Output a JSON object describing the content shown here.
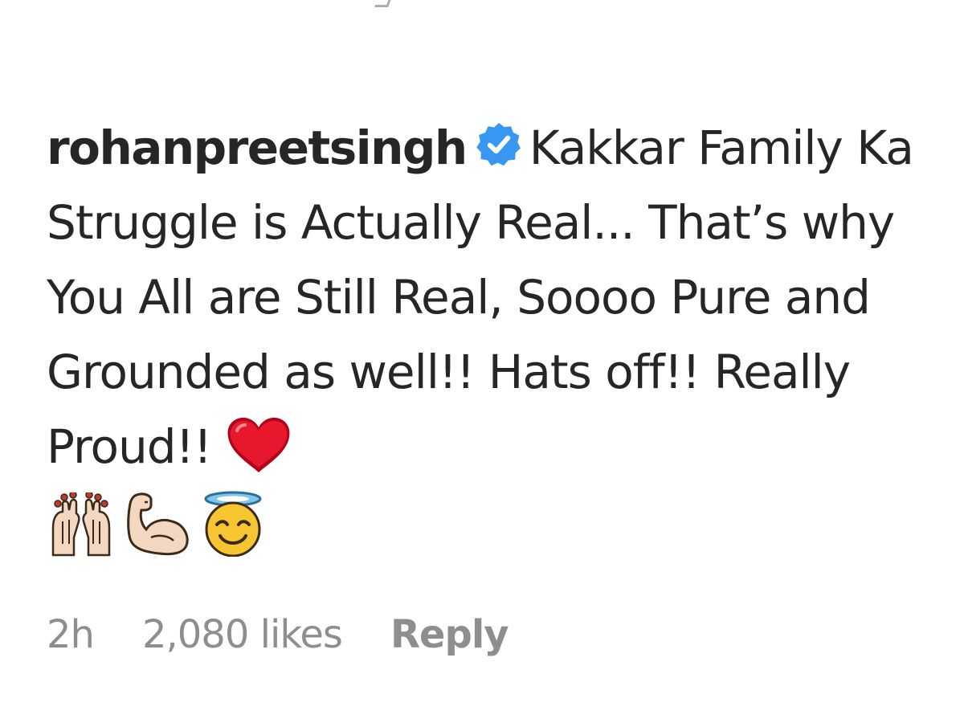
{
  "comment": {
    "username": "rohanpreetsingh",
    "verified": true,
    "text": "Kakkar Family Ka Struggle is Actually Real... That’s why You All are Still Real, Soooo Pure and Grounded as well!! Hats off!! Really Proud!!",
    "inline_emoji": "red-heart",
    "trailing_emojis": [
      "raising-hands",
      "flexed-biceps",
      "smiling-face-with-halo"
    ]
  },
  "meta": {
    "time": "2h",
    "likes": "2,080 likes",
    "reply_label": "Reply"
  },
  "colors": {
    "text": "#262626",
    "muted": "#8e8e8e",
    "verified_blue": "#3897f0",
    "heart_red": "#d0021b"
  }
}
